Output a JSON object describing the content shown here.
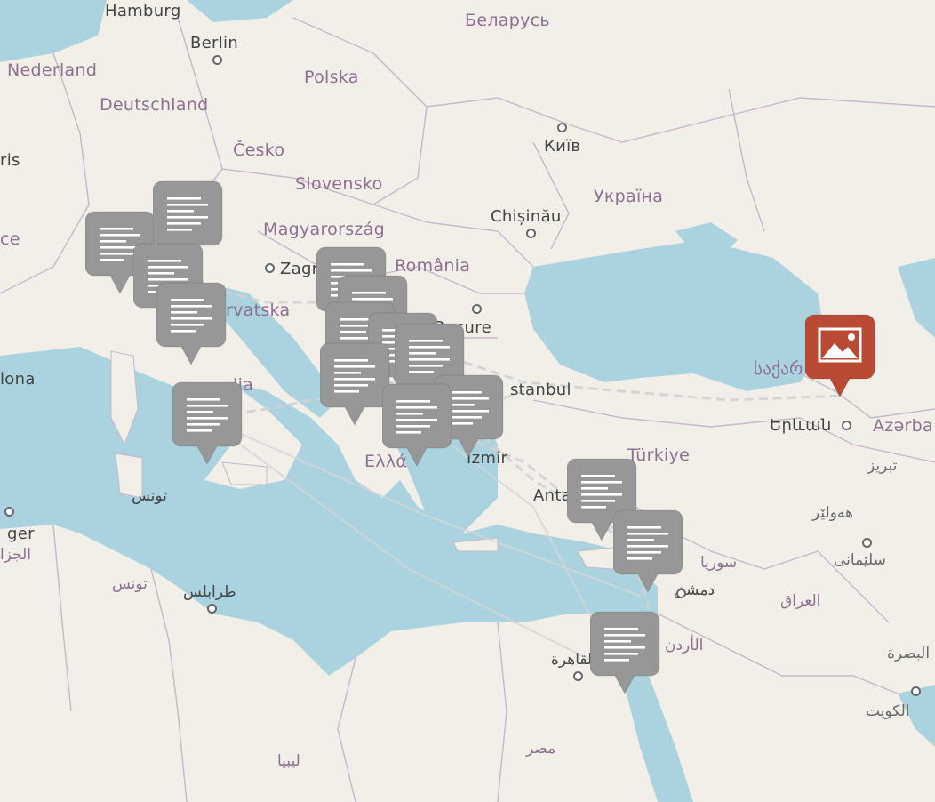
{
  "labels": [
    {
      "text": "Hamburg",
      "cls": "city dark"
    },
    {
      "text": "Berlin",
      "cls": "city dark"
    },
    {
      "text": "Nederland",
      "cls": "country"
    },
    {
      "text": "Deutschland",
      "cls": "country"
    },
    {
      "text": "Polska",
      "cls": "country"
    },
    {
      "text": "Беларусь",
      "cls": "country"
    },
    {
      "text": "Česko",
      "cls": "country"
    },
    {
      "text": "Київ",
      "cls": "city dark"
    },
    {
      "text": "Slovensko",
      "cls": "country"
    },
    {
      "text": "Україна",
      "cls": "country"
    },
    {
      "text": "Magyarország",
      "cls": "country"
    },
    {
      "text": "Chișinău",
      "cls": "city dark"
    },
    {
      "text": "Zagr",
      "cls": "city dark"
    },
    {
      "text": "România",
      "cls": "country"
    },
    {
      "text": "rvatska",
      "cls": "country"
    },
    {
      "text": "Bucure",
      "cls": "city dark"
    },
    {
      "text": "ris",
      "cls": "city dark"
    },
    {
      "text": "ce",
      "cls": "country"
    },
    {
      "text": "lona",
      "cls": "city dark"
    },
    {
      "text": "lia",
      "cls": "country"
    },
    {
      "text": "stanbul",
      "cls": "city dark"
    },
    {
      "text": "საქარ",
      "cls": "country"
    },
    {
      "text": "Երևան",
      "cls": "city dark"
    },
    {
      "text": "Azərba",
      "cls": "country"
    },
    {
      "text": "Türkiye",
      "cls": "country"
    },
    {
      "text": "İzmir",
      "cls": "city dark"
    },
    {
      "text": "Ελλά",
      "cls": "country"
    },
    {
      "text": "Anta",
      "cls": "city dark"
    },
    {
      "text": "تبريز",
      "cls": "city small"
    },
    {
      "text": "هەولێر",
      "cls": "city small"
    },
    {
      "text": "سلێمانی",
      "cls": "city small"
    },
    {
      "text": "تونس",
      "cls": "city dark small"
    },
    {
      "text": "ger",
      "cls": "city dark"
    },
    {
      "text": "الجزا",
      "cls": "country small"
    },
    {
      "text": "تونس",
      "cls": "country small"
    },
    {
      "text": "طرابلس",
      "cls": "city dark small"
    },
    {
      "text": "سوريا",
      "cls": "country small"
    },
    {
      "text": "دمشق",
      "cls": "city dark small"
    },
    {
      "text": "العراق",
      "cls": "country small"
    },
    {
      "text": "الأردن",
      "cls": "country small"
    },
    {
      "text": "القاهرة",
      "cls": "city dark small"
    },
    {
      "text": "البصرة",
      "cls": "city small"
    },
    {
      "text": "الكويت",
      "cls": "city small"
    },
    {
      "text": "ليبيا",
      "cls": "country small"
    },
    {
      "text": "مصر",
      "cls": "country small"
    }
  ],
  "markers": [
    {
      "type": "text",
      "color": "#979797"
    },
    {
      "type": "text",
      "color": "#979797"
    },
    {
      "type": "text",
      "color": "#979797"
    },
    {
      "type": "text",
      "color": "#979797"
    },
    {
      "type": "text",
      "color": "#979797"
    },
    {
      "type": "text",
      "color": "#979797"
    },
    {
      "type": "text",
      "color": "#979797"
    },
    {
      "type": "text",
      "color": "#979797"
    },
    {
      "type": "text",
      "color": "#979797"
    },
    {
      "type": "text",
      "color": "#979797"
    },
    {
      "type": "text",
      "color": "#979797"
    },
    {
      "type": "text",
      "color": "#979797"
    },
    {
      "type": "text",
      "color": "#979797"
    },
    {
      "type": "text",
      "color": "#979797"
    },
    {
      "type": "text",
      "color": "#979797"
    },
    {
      "type": "text",
      "color": "#979797"
    },
    {
      "type": "image",
      "color": "#b94a33"
    }
  ],
  "colors": {
    "water": "#aad3df",
    "land": "#f2efe9",
    "border": "#c6b7c9",
    "route": "#d6d6d6"
  }
}
